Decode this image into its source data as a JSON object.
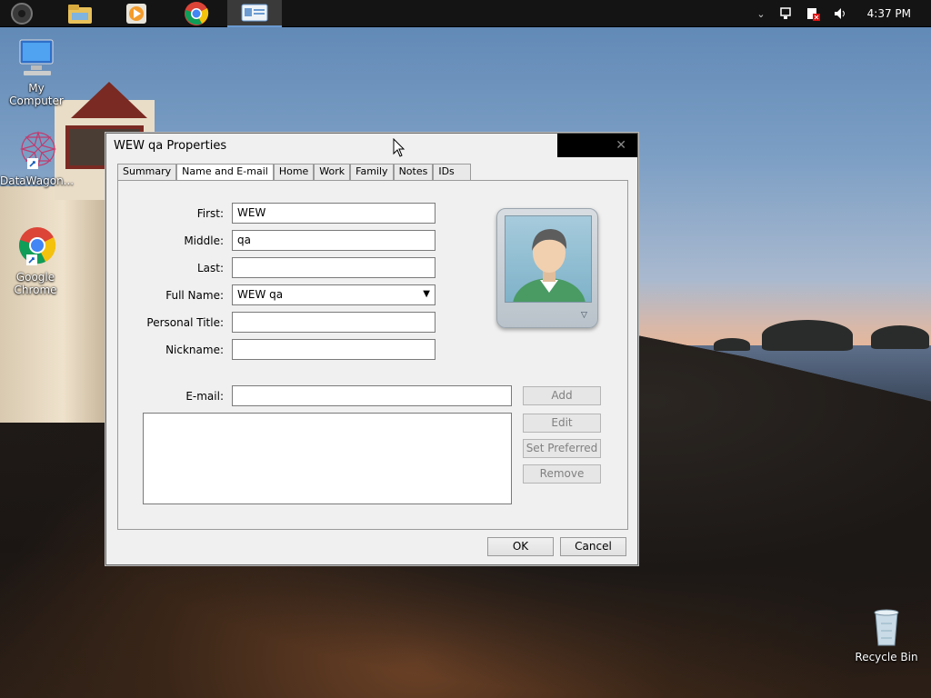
{
  "taskbar": {
    "apps": [
      {
        "name": "start",
        "icon": "start-orb-icon"
      },
      {
        "name": "file-explorer",
        "icon": "folder-icon"
      },
      {
        "name": "media-player",
        "icon": "media-player-icon"
      },
      {
        "name": "chrome",
        "icon": "chrome-icon"
      },
      {
        "name": "contacts",
        "icon": "contact-card-icon",
        "active": true
      }
    ],
    "tray": {
      "clock": "4:37 PM"
    }
  },
  "desktop": {
    "icons": [
      {
        "label": "My Computer"
      },
      {
        "label": "DataWagon..."
      },
      {
        "label": "Google Chrome"
      },
      {
        "label": "Recycle Bin"
      }
    ]
  },
  "dialog": {
    "title": "WEW qa Properties",
    "tabs": [
      "Summary",
      "Name and E-mail",
      "Home",
      "Work",
      "Family",
      "Notes",
      "IDs"
    ],
    "active_tab": "Name and E-mail",
    "fields": {
      "first_label": "First:",
      "first_value": "WEW",
      "middle_label": "Middle:",
      "middle_value": "qa",
      "last_label": "Last:",
      "last_value": "",
      "fullname_label": "Full Name:",
      "fullname_value": "WEW qa",
      "title_label": "Personal Title:",
      "title_value": "",
      "nickname_label": "Nickname:",
      "nickname_value": "",
      "email_label": "E-mail:",
      "email_value": ""
    },
    "email_buttons": {
      "add": "Add",
      "edit": "Edit",
      "set_preferred": "Set Preferred",
      "remove": "Remove"
    },
    "footer": {
      "ok": "OK",
      "cancel": "Cancel"
    }
  },
  "colors": {
    "accent": "#6b9bd1",
    "dialog_bg": "#f0f0f0",
    "taskbar_bg": "#141414"
  }
}
